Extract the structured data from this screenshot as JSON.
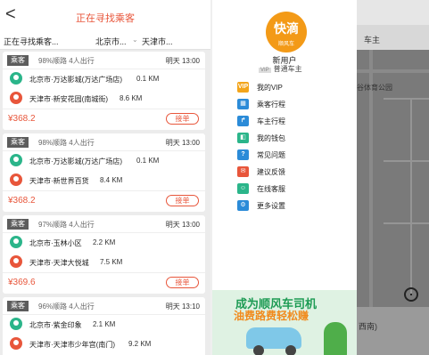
{
  "header": {
    "back_icon": "back-arrow-icon",
    "back_glyph": "<",
    "title": "正在寻找乘客"
  },
  "filters": {
    "status": "正在寻找乘客...",
    "from": "北京市...",
    "to": "天津市..."
  },
  "cards": [
    {
      "tag": "乘客",
      "match": "98%顺路",
      "people": "4人出行",
      "time": "明天 13:00",
      "start": "北京市·万达影城(万达广场店)",
      "start_dist": "0.1 KM",
      "end": "天津市·新安花园(南城街)",
      "end_dist": "8.6 KM",
      "price": "¥368.2",
      "action": "接单"
    },
    {
      "tag": "乘客",
      "match": "98%顺路",
      "people": "4人出行",
      "time": "明天 13:00",
      "start": "北京市·万达影城(万达广场店)",
      "start_dist": "0.1 KM",
      "end": "天津市·新世界百货",
      "end_dist": "8.4 KM",
      "price": "¥368.2",
      "action": "接单"
    },
    {
      "tag": "乘客",
      "match": "97%顺路",
      "people": "4人出行",
      "time": "明天 13:00",
      "start": "北京市·玉林小区",
      "start_dist": "2.2 KM",
      "end": "天津市·天津大悦城",
      "end_dist": "7.5 KM",
      "price": "¥369.6",
      "action": "接单"
    },
    {
      "tag": "乘客",
      "match": "96%顺路",
      "people": "4人出行",
      "time": "明天 13:10",
      "start": "北京市·紫金印象",
      "start_dist": "2.1 KM",
      "end": "天津市·天津市少年宫(南门)",
      "end_dist": "9.2 KM"
    }
  ],
  "drawer": {
    "logo_main": "快滴",
    "logo_sub": "顺风车",
    "user_name": "新用户",
    "vip_badge": "VIP",
    "user_level": "普通车主",
    "menu": [
      {
        "label": "我的VIP",
        "icon": "vip-icon",
        "icon_text": "VIP",
        "color": "#f3a51b"
      },
      {
        "label": "乘客行程",
        "icon": "calendar-icon",
        "icon_text": "▦",
        "color": "#2b8bd8"
      },
      {
        "label": "车主行程",
        "icon": "route-icon",
        "icon_text": "↱",
        "color": "#2b8bd8"
      },
      {
        "label": "我的钱包",
        "icon": "wallet-icon",
        "icon_text": "◧",
        "color": "#2bb58a"
      },
      {
        "label": "常见问题",
        "icon": "faq-icon",
        "icon_text": "?",
        "color": "#2b8bd8"
      },
      {
        "label": "建议反馈",
        "icon": "mail-icon",
        "icon_text": "✉",
        "color": "#e8563b"
      },
      {
        "label": "在线客服",
        "icon": "service-icon",
        "icon_text": "☺",
        "color": "#2bb58a"
      },
      {
        "label": "更多设置",
        "icon": "gear-icon",
        "icon_text": "⚙",
        "color": "#2b8bd8"
      }
    ],
    "banner_line1": "成为顺风车司机",
    "banner_line2": "油费路费轻松赚"
  },
  "map": {
    "tab_label": "车主",
    "poi_label": "谷体育公园",
    "bottom_text": "西南)"
  },
  "colors": {
    "accent": "#e8563b",
    "green": "#2bb58a",
    "logo": "#f39a17"
  }
}
